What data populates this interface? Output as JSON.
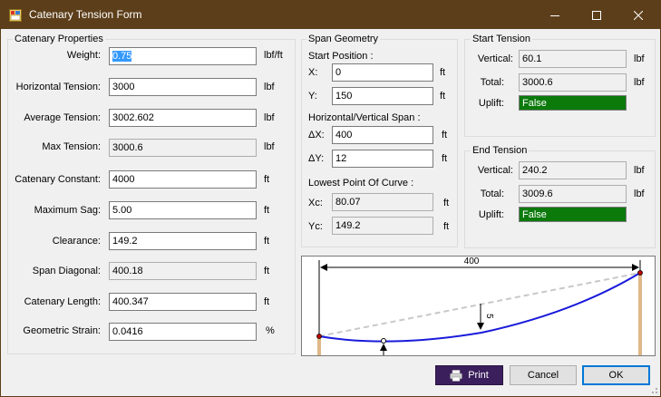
{
  "window": {
    "title": "Catenary Tension Form"
  },
  "catenary": {
    "legend": "Catenary Properties",
    "weight": {
      "label": "Weight:",
      "value": "0.75",
      "unit": "lbf/ft"
    },
    "htension": {
      "label": "Horizontal Tension:",
      "value": "3000",
      "unit": "lbf"
    },
    "avgtension": {
      "label": "Average Tension:",
      "value": "3002.602",
      "unit": "lbf"
    },
    "maxtension": {
      "label": "Max Tension:",
      "value": "3000.6",
      "unit": "lbf"
    },
    "constant": {
      "label": "Catenary Constant:",
      "value": "4000",
      "unit": "ft"
    },
    "maxsag": {
      "label": "Maximum Sag:",
      "value": "5.00",
      "unit": "ft"
    },
    "clearance": {
      "label": "Clearance:",
      "value": "149.2",
      "unit": "ft"
    },
    "diagonal": {
      "label": "Span Diagonal:",
      "value": "400.18",
      "unit": "ft"
    },
    "length": {
      "label": "Catenary Length:",
      "value": "400.347",
      "unit": "ft"
    },
    "strain": {
      "label": "Geometric Strain:",
      "value": "0.0416",
      "unit": "%"
    }
  },
  "span": {
    "legend": "Span Geometry",
    "start_heading": "Start Position :",
    "x": {
      "label": "X:",
      "value": "0",
      "unit": "ft"
    },
    "y": {
      "label": "Y:",
      "value": "150",
      "unit": "ft"
    },
    "hv_heading": "Horizontal/Vertical Span :",
    "dx": {
      "label": "ΔX:",
      "value": "400",
      "unit": "ft"
    },
    "dy": {
      "label": "ΔY:",
      "value": "12",
      "unit": "ft"
    },
    "low_heading": "Lowest Point Of Curve :",
    "xc": {
      "label": "Xc:",
      "value": "80.07",
      "unit": "ft"
    },
    "yc": {
      "label": "Yc:",
      "value": "149.2",
      "unit": "ft"
    }
  },
  "start_tension": {
    "legend": "Start Tension",
    "vertical": {
      "label": "Vertical:",
      "value": "60.1",
      "unit": "lbf"
    },
    "total": {
      "label": "Total:",
      "value": "3000.6",
      "unit": "lbf"
    },
    "uplift": {
      "label": "Uplift:",
      "value": "False"
    }
  },
  "end_tension": {
    "legend": "End Tension",
    "vertical": {
      "label": "Vertical:",
      "value": "240.2",
      "unit": "lbf"
    },
    "total": {
      "label": "Total:",
      "value": "3009.6",
      "unit": "lbf"
    },
    "uplift": {
      "label": "Uplift:",
      "value": "False"
    }
  },
  "diagram": {
    "span_label": "400",
    "sag_label": "5"
  },
  "buttons": {
    "print": "Print",
    "cancel": "Cancel",
    "ok": "OK"
  },
  "colors": {
    "title_bar": "#5c3e1a",
    "uplift_false": "#0b7a0b",
    "print_button": "#3b1f5c",
    "curve": "#1a1adb",
    "pole": "#deb887"
  },
  "icons": {
    "app": "form-icon",
    "print": "printer-icon"
  }
}
